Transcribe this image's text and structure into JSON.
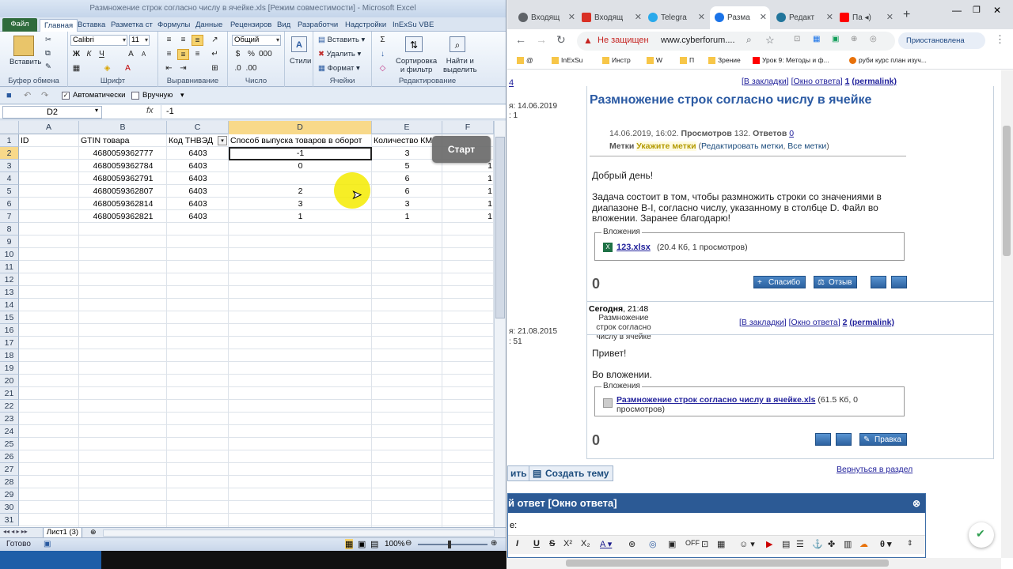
{
  "excel": {
    "title": "Размножение строк согласно числу в ячейке.xls  [Режим совместимости]  -  Microsoft Excel",
    "tabs": [
      "Файл",
      "Главная",
      "Вставка",
      "Разметка ст",
      "Формулы",
      "Данные",
      "Рецензиров",
      "Вид",
      "Разработчи",
      "Надстройки",
      "InExSu VBE"
    ],
    "ribbon": {
      "paste": "Вставить",
      "clipboard": "Буфер обмена",
      "font_name": "Calibri",
      "font_size": "11",
      "font_group": "Шрифт",
      "align_group": "Выравнивание",
      "number_format": "Общий",
      "number_group": "Число",
      "styles": "Стили",
      "insert": "Вставить",
      "delete": "Удалить",
      "format": "Формат",
      "cells_group": "Ячейки",
      "sort": "Сортировка\nи фильтр",
      "find": "Найти и\nвыделить",
      "edit_group": "Редактирование"
    },
    "qat": {
      "auto": "Автоматически",
      "manual": "Вручную"
    },
    "namebox": "D2",
    "fx": "fx",
    "formula": "-1",
    "columns": [
      "A",
      "B",
      "C",
      "D",
      "E",
      "F"
    ],
    "headers": [
      "ID",
      "GTIN товара",
      "Код ТНВЭД",
      "Способ выпуска товаров в оборот",
      "Количество КМ",
      ""
    ],
    "rows": [
      [
        "",
        "4680059362777",
        "6403",
        "-1",
        "3",
        ""
      ],
      [
        "",
        "4680059362784",
        "6403",
        "0",
        "5",
        "1"
      ],
      [
        "",
        "4680059362791",
        "6403",
        "",
        "6",
        "1"
      ],
      [
        "",
        "4680059362807",
        "6403",
        "2",
        "6",
        "1"
      ],
      [
        "",
        "4680059362814",
        "6403",
        "3",
        "3",
        "1"
      ],
      [
        "",
        "4680059362821",
        "6403",
        "1",
        "1",
        "1"
      ]
    ],
    "row_numbers": [
      "1",
      "2",
      "3",
      "4",
      "5",
      "6",
      "7",
      "8",
      "9",
      "10",
      "11",
      "12",
      "13",
      "14",
      "15",
      "16",
      "17",
      "18",
      "19",
      "20",
      "21",
      "22",
      "23",
      "24",
      "25",
      "26",
      "27",
      "28",
      "29",
      "30",
      "31"
    ],
    "sheet_tab": "Лист1 (3)",
    "status": "Готово",
    "zoom": "100%",
    "start_btn": "Старт"
  },
  "chrome": {
    "tabs": [
      "Входящ",
      "Входящ",
      "Telegra",
      "Разма",
      "Редакт",
      "Па"
    ],
    "not_secure": "Не защищен",
    "url": "www.cyberforum....",
    "paused": "Приостановлена",
    "bookmarks": [
      "@",
      "InExSu",
      "Инстр",
      "W",
      "П",
      "Зрение",
      "Урок 9: Методы и ф...",
      "руби курс план изуч..."
    ]
  },
  "forum": {
    "post1": {
      "left_num": "4",
      "left_date": "я: 14.06.2019",
      "left_count": ": 1",
      "links": "[В закладки] [Окно ответа]",
      "num": "1",
      "permalink": "(permalink)",
      "title": "Размножение строк согласно числу в ячейке",
      "meta_date": "14.06.2019, 16:02.",
      "views_label": "Просмотров",
      "views": "132.",
      "answers_label": "Ответов",
      "answers": "0",
      "tags_label": "Метки",
      "tags_value": "Укажите метки",
      "edit_tags": "Редактировать метки",
      "all_tags": "Все метки",
      "body1": "Добрый день!",
      "body2": "Задача состоит в том, чтобы размножить строки со значениями в диапазоне B-I, согласно числу, указанному в столбце D. Файл во вложении. Заранее благодарю!",
      "att_legend": "Вложения",
      "att_name": "123.xlsx",
      "att_info": "(20.4 Кб, 1 просмотров)",
      "rating": "0",
      "thanks": "Спасибо",
      "review": "Отзыв"
    },
    "post2": {
      "date_bold": "Сегодня",
      "time": ", 21:48",
      "subtitle": "Размножение строк согласно числу в ячейке",
      "left_date": "я: 21.08.2015",
      "left_count": ": 51",
      "num": "2",
      "permalink": "(permalink)",
      "body1": "Привет!",
      "body2": "Во вложении.",
      "att_legend": "Вложения",
      "att_name": "Размножение строк согласно числу в ячейке.xls",
      "att_info": "(61.5 Кб, 0 просмотров)",
      "rating": "0",
      "edit": "Правка"
    },
    "new_topic_left": "ить",
    "new_topic": "Создать тему",
    "back": "Вернуться в раздел",
    "reply_head": "й ответ [Окно ответа]",
    "reply_label": "е:"
  }
}
